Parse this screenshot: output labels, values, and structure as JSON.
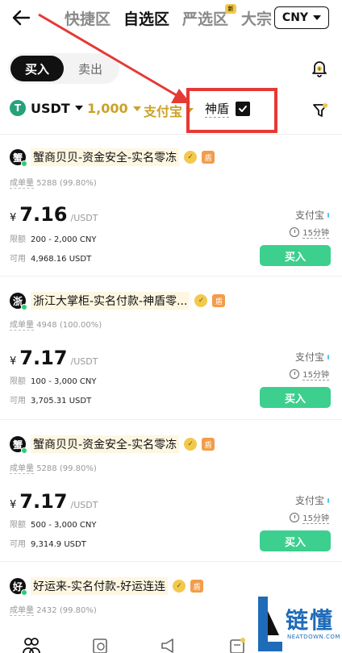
{
  "nav": {
    "tabs": [
      {
        "label": "快捷区"
      },
      {
        "label": "自选区"
      },
      {
        "label": "严选区",
        "badge": "新"
      },
      {
        "label": "大宗"
      }
    ],
    "currency": "CNY"
  },
  "trade_toggle": {
    "buy": "买入",
    "sell": "卖出"
  },
  "filters": {
    "coin": "USDT",
    "coin_icon_letter": "T",
    "amount": "1,000",
    "payment": "支付宝",
    "shield_label": "神盾"
  },
  "labels": {
    "orders": "成单量",
    "limit": "限额",
    "available": "可用",
    "buy_button": "买入",
    "price_unit": "/USDT",
    "currency_symbol": "¥"
  },
  "listings": [
    {
      "avatar": "蟹",
      "name": "蟹商贝贝-资金安全-实名零冻",
      "orders": "5288 (99.80%)",
      "price": "7.16",
      "limit": "200 - 2,000 CNY",
      "available": "4,968.16 USDT",
      "method": "支付宝",
      "time_limit": "15分钟"
    },
    {
      "avatar": "浙",
      "name": "浙江大掌柜-实名付款-神盾零...",
      "orders": "4948 (100.00%)",
      "price": "7.17",
      "limit": "100 - 3,000 CNY",
      "available": "3,705.31 USDT",
      "method": "支付宝",
      "time_limit": "15分钟"
    },
    {
      "avatar": "蟹",
      "name": "蟹商贝贝-资金安全-实名零冻",
      "orders": "5288 (99.80%)",
      "price": "7.17",
      "limit": "500 - 3,000 CNY",
      "available": "9,314.9 USDT",
      "method": "支付宝",
      "time_limit": "15分钟"
    },
    {
      "avatar": "好",
      "name": "好运来-实名付款-好运连连",
      "orders": "2432 (99.80%)"
    }
  ],
  "watermark": {
    "text": "链懂",
    "url": "NEATDOWN.COM"
  },
  "colors": {
    "accent_gold": "#c9a227",
    "buy_green": "#3ccf8e",
    "highlight_red": "#e53935",
    "arrow_red": "#e53935"
  }
}
